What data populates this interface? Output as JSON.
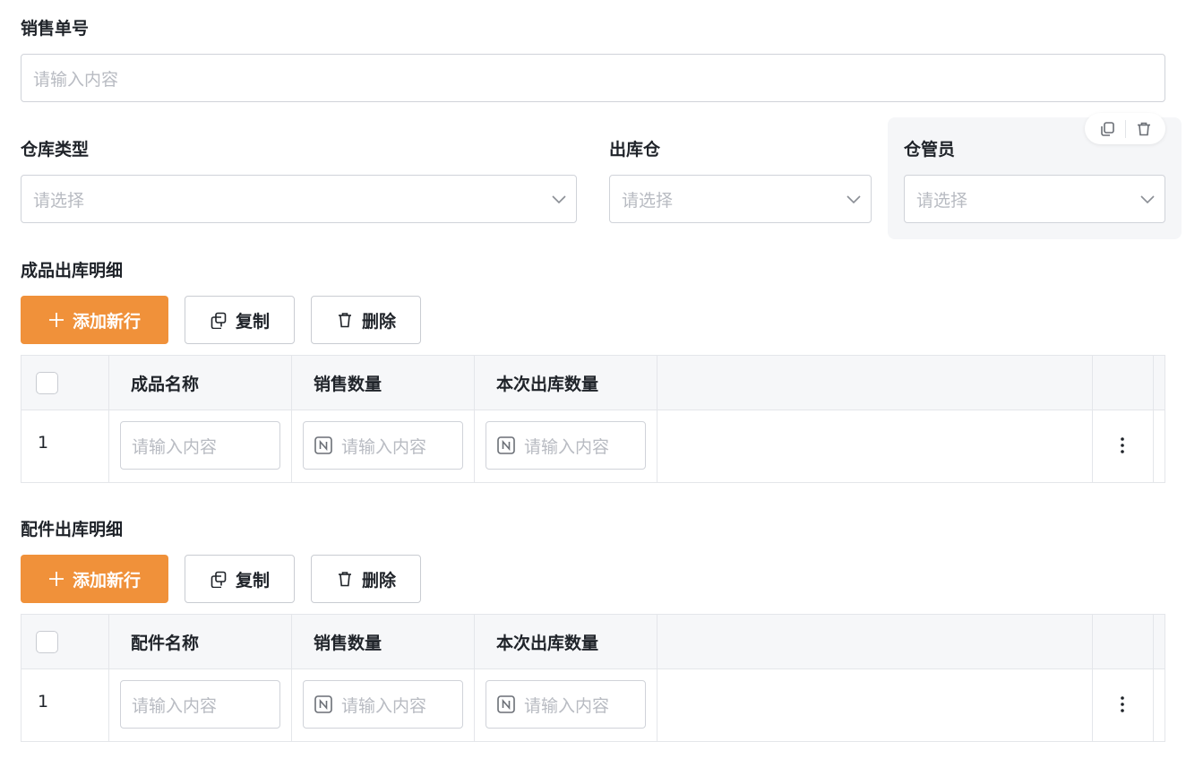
{
  "sales_no": {
    "label": "销售单号",
    "placeholder": "请输入内容"
  },
  "warehouse_type": {
    "label": "仓库类型",
    "placeholder": "请选择"
  },
  "outbound_warehouse": {
    "label": "出库仓",
    "placeholder": "请选择"
  },
  "keeper": {
    "label": "仓管员",
    "placeholder": "请选择"
  },
  "float_toolbar": {
    "icons": [
      "copy-icon",
      "trash-icon"
    ]
  },
  "product_section": {
    "title": "成品出库明细",
    "add_label": "添加新行",
    "copy_label": "复制",
    "delete_label": "删除",
    "columns": [
      "成品名称",
      "销售数量",
      "本次出库数量"
    ],
    "rows": [
      {
        "index": "1",
        "name_placeholder": "请输入内容",
        "qty_placeholder": "请输入内容",
        "out_qty_placeholder": "请输入内容"
      }
    ]
  },
  "parts_section": {
    "title": "配件出库明细",
    "add_label": "添加新行",
    "copy_label": "复制",
    "delete_label": "删除",
    "columns": [
      "配件名称",
      "销售数量",
      "本次出库数量"
    ],
    "rows": [
      {
        "index": "1",
        "name_placeholder": "请输入内容",
        "qty_placeholder": "请输入内容",
        "out_qty_placeholder": "请输入内容"
      }
    ]
  },
  "colors": {
    "primary": "#f0913a",
    "border": "#d0d3d9",
    "placeholder": "#b8bbc2",
    "header_bg": "#f6f7f9"
  }
}
